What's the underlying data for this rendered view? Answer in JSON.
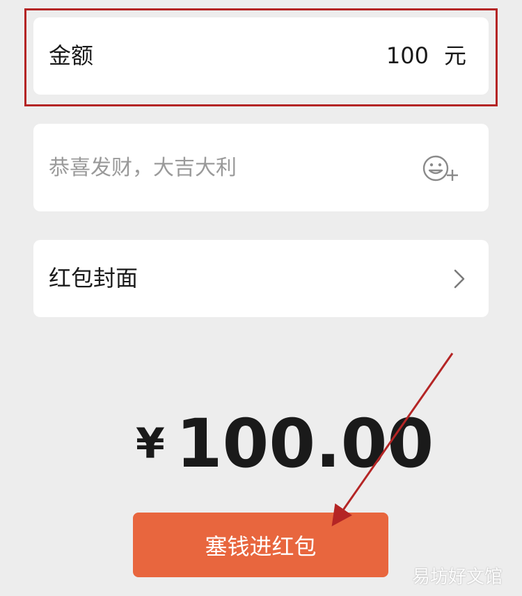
{
  "amount_card": {
    "label": "金额",
    "value": "100",
    "unit": "元"
  },
  "greeting": {
    "placeholder": "恭喜发财，大吉大利",
    "emoji_icon": "emoji-add-icon"
  },
  "cover": {
    "label": "红包封面",
    "chevron_icon": "chevron-right-icon"
  },
  "total": {
    "currency": "¥",
    "amount": "100.00"
  },
  "submit": {
    "label": "塞钱进红包"
  },
  "watermark": "易坊好文馆",
  "colors": {
    "background": "#ededed",
    "card": "#ffffff",
    "button": "#e8663e",
    "highlight": "#b42525"
  }
}
